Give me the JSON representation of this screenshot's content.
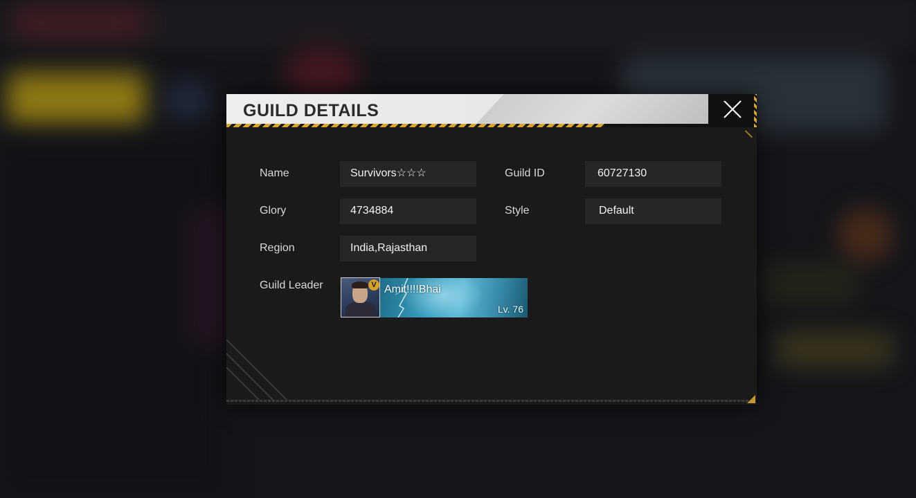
{
  "dialog": {
    "title": "GUILD DETAILS"
  },
  "fields": {
    "name_label": "Name",
    "name_value": "Survivors☆☆☆",
    "guild_id_label": "Guild ID",
    "guild_id_value": "60727130",
    "glory_label": "Glory",
    "glory_value": "4734884",
    "style_label": "Style",
    "style_value": "Default",
    "region_label": "Region",
    "region_value": "India,Rajasthan",
    "leader_label": "Guild Leader"
  },
  "leader": {
    "name": "Amit!!!!Bhai",
    "level": "Lv. 76",
    "badge": "V"
  },
  "icons": {
    "close": "close-icon",
    "avatar": "player-avatar",
    "badge": "vip-badge-icon"
  },
  "colors": {
    "accent": "#d9a531",
    "panel": "#1a1a1a",
    "field": "#262626",
    "banner": "#3a9fbf"
  }
}
